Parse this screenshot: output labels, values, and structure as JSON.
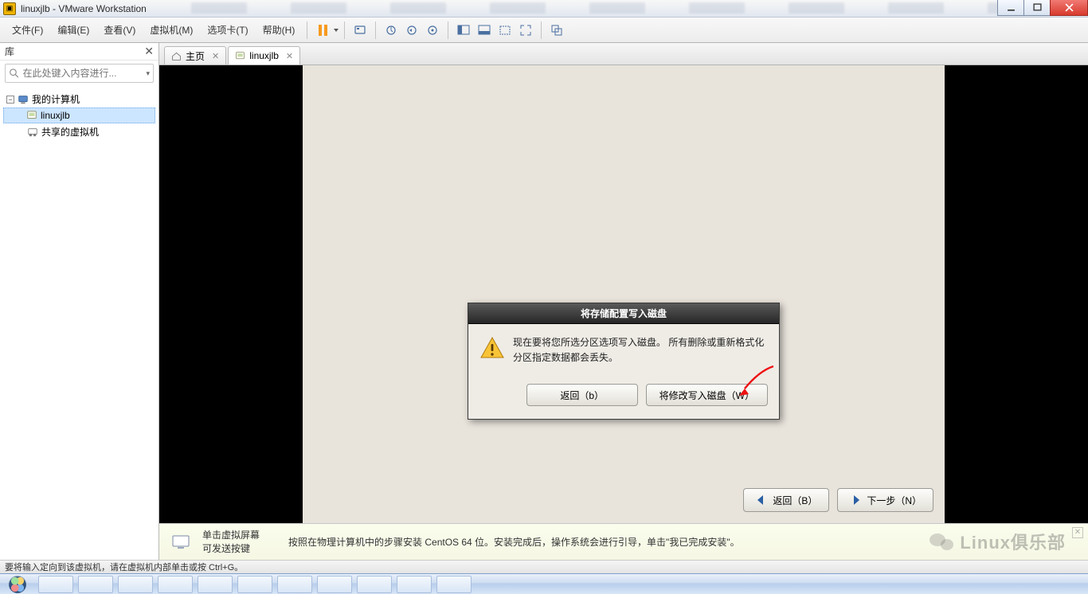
{
  "window": {
    "title": "linuxjlb - VMware Workstation"
  },
  "menu": {
    "file": "文件(F)",
    "edit": "编辑(E)",
    "view": "查看(V)",
    "vm": "虚拟机(M)",
    "tabs": "选项卡(T)",
    "help": "帮助(H)"
  },
  "sidebar": {
    "title": "库",
    "search_placeholder": "在此处键入内容进行...",
    "nodes": {
      "root": "我的计算机",
      "vm": "linuxjlb",
      "shared": "共享的虚拟机"
    }
  },
  "tabs": {
    "home": "主页",
    "vm": "linuxjlb"
  },
  "dialog": {
    "title": "将存储配置写入磁盘",
    "message": "现在要将您所选分区选项写入磁盘。 所有删除或重新格式化分区指定数据都会丢失。",
    "back_btn": "返回（b）",
    "write_btn": "将修改写入磁盘（W）"
  },
  "wizard": {
    "back": "返回（B）",
    "next": "下一步（N）"
  },
  "hint": {
    "line1": "单击虚拟屏幕",
    "line2": "可发送按键",
    "desc": "按照在物理计算机中的步骤安装 CentOS 64 位。安装完成后，操作系统会进行引导，单击\"我已完成安装\"。"
  },
  "status": {
    "text": "要将输入定向到该虚拟机，请在虚拟机内部单击或按 Ctrl+G。"
  },
  "watermark": "Linux俱乐部"
}
